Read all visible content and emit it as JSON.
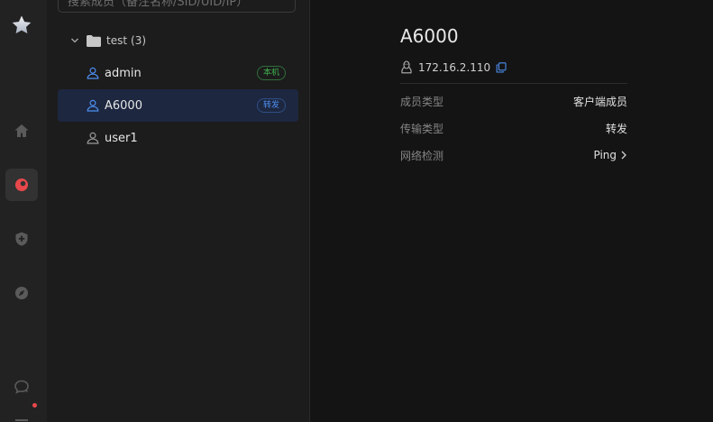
{
  "search": {
    "placeholder": "搜索成员（备注名称/SID/UID/IP）"
  },
  "group": {
    "name": "test",
    "count": "(3)"
  },
  "members": [
    {
      "name": "admin",
      "badge": "本机"
    },
    {
      "name": "A6000",
      "badge": "转发"
    },
    {
      "name": "user1"
    }
  ],
  "detail": {
    "title": "A6000",
    "ip": "172.16.2.110",
    "rows": [
      {
        "label": "成员类型",
        "value": "客户端成员"
      },
      {
        "label": "传输类型",
        "value": "转发"
      },
      {
        "label": "网络检测",
        "value": "Ping"
      }
    ]
  },
  "colors": {
    "accent_blue": "#4d8ef0",
    "badge_green": "#3fb24f",
    "active_red": "#e8484b",
    "selected_row": "#1d2740"
  },
  "icons": {
    "rail": [
      "star-logo-icon",
      "home-icon",
      "network-icon",
      "shield-plus-icon",
      "compass-icon",
      "chat-icon",
      "menu-icon"
    ],
    "member": "user-icon",
    "os": "linux-icon",
    "copy": "copy-icon"
  }
}
